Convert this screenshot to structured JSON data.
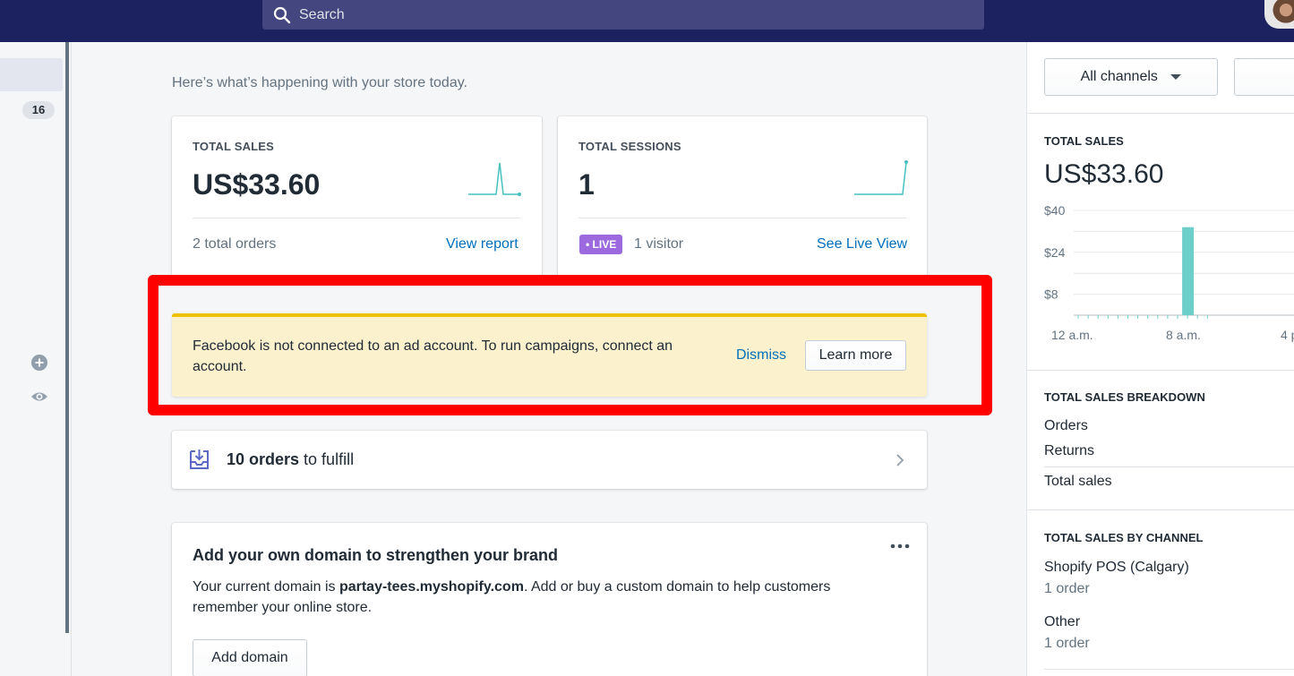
{
  "header": {
    "search_placeholder": "Search"
  },
  "sidebar": {
    "badge_count": "16"
  },
  "main": {
    "subtitle": "Here’s what’s happening with your store today.",
    "total_sales_card": {
      "label": "TOTAL SALES",
      "value": "US$33.60",
      "footer": "2 total orders",
      "link": "View report"
    },
    "total_sessions_card": {
      "label": "TOTAL SESSIONS",
      "value": "1",
      "live_badge": "• LIVE",
      "visitors": "1 visitor",
      "link": "See Live View"
    },
    "facebook_banner": {
      "message": "Facebook is not connected to an ad account. To run campaigns, connect an account.",
      "dismiss": "Dismiss",
      "learn_more": "Learn more"
    },
    "orders_card": {
      "count": "10 orders",
      "suffix": " to fulfill"
    },
    "domain_card": {
      "title": "Add your own domain to strengthen your brand",
      "body_prefix": "Your current domain is ",
      "domain": "partay-tees.myshopify.com",
      "body_suffix": ". Add or buy a custom domain to help customers remember your online store.",
      "button": "Add domain"
    }
  },
  "right_panel": {
    "channel_select": "All channels",
    "total_sales_label": "TOTAL SALES",
    "total_sales_value": "US$33.60",
    "breakdown_label": "TOTAL SALES BREAKDOWN",
    "breakdown_items": [
      "Orders",
      "Returns",
      "Total sales"
    ],
    "by_channel_label": "TOTAL SALES BY CHANNEL",
    "channels": [
      {
        "name": "Shopify POS (Calgary)",
        "orders": "1 order"
      },
      {
        "name": "Other",
        "orders": "1 order"
      }
    ]
  },
  "chart_data": {
    "type": "bar",
    "title": "",
    "y_tick_labels": [
      "$40",
      "$24",
      "$8"
    ],
    "x_tick_labels": [
      "12 a.m.",
      "8 a.m.",
      "4 p"
    ],
    "hours": [
      0,
      1,
      2,
      3,
      4,
      5,
      6,
      7,
      8,
      9,
      10,
      11,
      12,
      13
    ],
    "values": [
      0,
      0,
      0,
      0,
      0,
      0,
      0,
      0,
      0,
      0,
      0,
      33.6,
      0,
      0
    ],
    "ylim": [
      0,
      40
    ]
  },
  "colors": {
    "topbar": "#1c2260",
    "link": "#006fbb",
    "live_badge": "#9c6ade",
    "banner_bg": "#fcf1cd",
    "banner_accent": "#eec200",
    "highlight_frame": "#ff0000",
    "chart_bar": "#6dcfc9"
  }
}
